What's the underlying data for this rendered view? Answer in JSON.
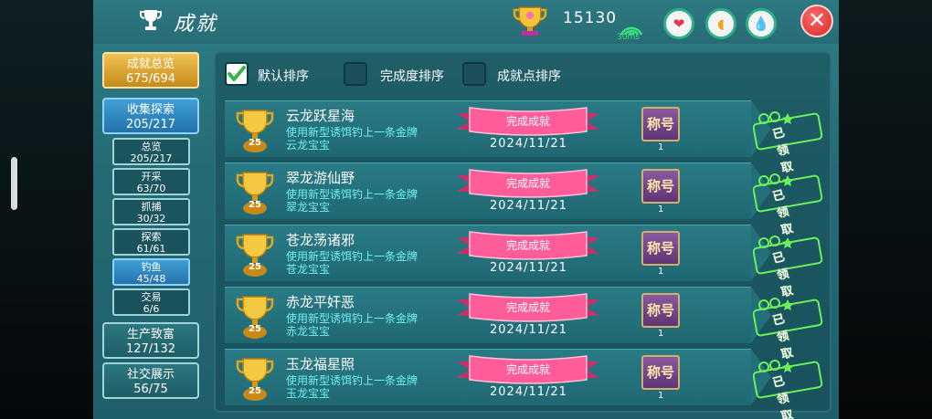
{
  "header": {
    "title": "成就",
    "points": "15130",
    "ping": "30ms"
  },
  "stat_buttons": [
    {
      "name": "heart",
      "icon": "heart-icon",
      "color": "#e0374a"
    },
    {
      "name": "strength",
      "icon": "muscle-icon",
      "color": "#f0a520"
    },
    {
      "name": "water",
      "icon": "water-drop-icon",
      "color": "#1a8a9a"
    }
  ],
  "sidebar": {
    "main": [
      {
        "label": "成就总览",
        "count": "675/694"
      },
      {
        "label": "收集探索",
        "count": "205/217"
      }
    ],
    "sub": [
      {
        "label": "总览",
        "count": "205/217"
      },
      {
        "label": "开采",
        "count": "63/70"
      },
      {
        "label": "抓捕",
        "count": "30/32"
      },
      {
        "label": "探索",
        "count": "61/61"
      },
      {
        "label": "钓鱼",
        "count": "45/48"
      },
      {
        "label": "交易",
        "count": "6/6"
      }
    ],
    "more": [
      {
        "label": "生产致富",
        "count": "127/132"
      },
      {
        "label": "社交展示",
        "count": "56/75"
      }
    ]
  },
  "sort": {
    "options": [
      "默认排序",
      "完成度排序",
      "成就点排序"
    ],
    "selected": "默认排序"
  },
  "achievements": [
    {
      "name": "云龙跃星海",
      "desc": "使用新型诱饵钓上一条金牌云龙宝宝",
      "desc_line1": "使用新型诱饵钓上一条金牌",
      "desc_line2": "云龙宝宝",
      "points": "25",
      "status": "完成成就",
      "date": "2024/11/21",
      "reward": "称号",
      "reward_count": "1",
      "claim": "已领取"
    },
    {
      "name": "翠龙游仙野",
      "desc": "使用新型诱饵钓上一条金牌翠龙宝宝",
      "desc_line1": "使用新型诱饵钓上一条金牌",
      "desc_line2": "翠龙宝宝",
      "points": "25",
      "status": "完成成就",
      "date": "2024/11/21",
      "reward": "称号",
      "reward_count": "1",
      "claim": "已领取"
    },
    {
      "name": "苍龙荡诸邪",
      "desc": "使用新型诱饵钓上一条金牌苍龙宝宝",
      "desc_line1": "使用新型诱饵钓上一条金牌",
      "desc_line2": "苍龙宝宝",
      "points": "25",
      "status": "完成成就",
      "date": "2024/11/21",
      "reward": "称号",
      "reward_count": "1",
      "claim": "已领取"
    },
    {
      "name": "赤龙平奸恶",
      "desc": "使用新型诱饵钓上一条金牌赤龙宝宝",
      "desc_line1": "使用新型诱饵钓上一条金牌",
      "desc_line2": "赤龙宝宝",
      "points": "25",
      "status": "完成成就",
      "date": "2024/11/21",
      "reward": "称号",
      "reward_count": "1",
      "claim": "已领取"
    },
    {
      "name": "玉龙福星照",
      "desc": "使用新型诱饵钓上一条金牌玉龙宝宝",
      "desc_line1": "使用新型诱饵钓上一条金牌",
      "desc_line2": "玉龙宝宝",
      "points": "25",
      "status": "完成成就",
      "date": "2024/11/21",
      "reward": "称号",
      "reward_count": "1",
      "claim": "已领取"
    }
  ]
}
